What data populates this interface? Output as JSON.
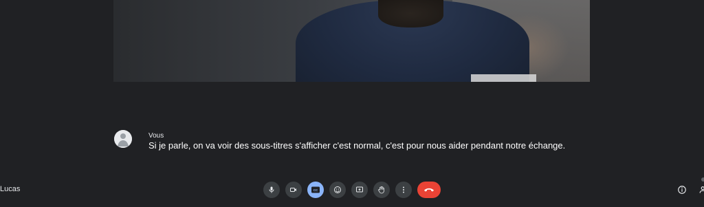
{
  "caption": {
    "speaker": "Vous",
    "text": "Si je parle, on va voir des sous-titres s'afficher c'est normal, c'est pour nous aider pendant notre échange."
  },
  "meeting": {
    "name": "Lucas"
  },
  "controls": [
    {
      "icon": "microphone-icon"
    },
    {
      "icon": "camera-icon"
    },
    {
      "icon": "captions-icon",
      "label": "CC",
      "active": true
    },
    {
      "icon": "emoji-icon"
    },
    {
      "icon": "present-screen-icon"
    },
    {
      "icon": "raise-hand-icon"
    },
    {
      "icon": "more-options-icon"
    },
    {
      "icon": "end-call-icon"
    }
  ],
  "right_icons": [
    {
      "icon": "info-icon"
    },
    {
      "icon": "people-icon"
    }
  ],
  "colors": {
    "background": "#202124",
    "control_bg": "#3c4043",
    "active_control": "#8ab4f8",
    "end_call": "#ea4335"
  }
}
